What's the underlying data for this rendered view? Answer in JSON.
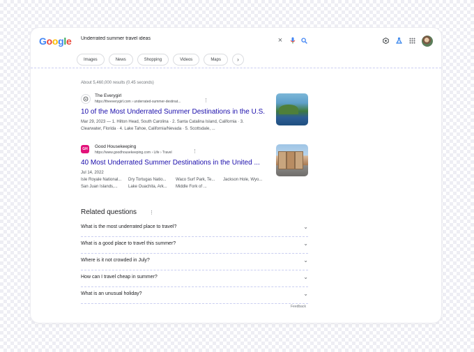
{
  "logo": {
    "letters": [
      "G",
      "o",
      "o",
      "g",
      "l",
      "e"
    ],
    "colors": [
      "#4285f4",
      "#ea4335",
      "#fbbc05",
      "#4285f4",
      "#34a853",
      "#ea4335"
    ]
  },
  "search": {
    "query": "Underrated summer travel ideas"
  },
  "icons": {
    "clear": "×",
    "mic": "🎤",
    "search": "⚲",
    "labs": "⚗",
    "apps": "⋮⋮⋮"
  },
  "tabs": [
    {
      "label": "Images"
    },
    {
      "label": "News"
    },
    {
      "label": "Shopping"
    },
    {
      "label": "Videos"
    },
    {
      "label": "Maps"
    }
  ],
  "stats": "About 5,460,000 results (0.45 seconds)",
  "results": [
    {
      "site": "The Everygirl",
      "url": "https://theeverygirl.com › underrated-summer-destinat...",
      "title": "10 of the Most Underrated Summer Destinations in the U.S.",
      "snippet_line1": "Mar 29, 2023 — 1. Hilton Head, South Carolina · 2. Santa Catalina Island, California · 3.",
      "snippet_line2": "Clearwater, Florida · 4. Lake Tahoe, California/Nevada · 5. Scottsdale, ..."
    },
    {
      "site": "Good Housekeeping",
      "url": "https://www.goodhousekeeping.com › Life › Travel",
      "title": "40 Most Underrated Summer Destinations in the United ...",
      "date": "Jul 14, 2022",
      "links_row1": [
        "Isle Royale National...",
        "Dry Tortugas Natio...",
        "Waco Surf Park, Te...",
        "Jackson Hole, Wyo..."
      ],
      "links_row2": [
        "San Juan Islands,...",
        "Lake Ouachita, Ark...",
        "Middle Fork of ..."
      ]
    }
  ],
  "related": {
    "title": "Related questions",
    "questions": [
      "What is the most underrated place to travel?",
      "What is a good place to travel this summer?",
      "Where is it not crowded in July?",
      "How can I travel cheap in summer?",
      "What is an unusual holiday?"
    ]
  },
  "feedback": "Feedback"
}
